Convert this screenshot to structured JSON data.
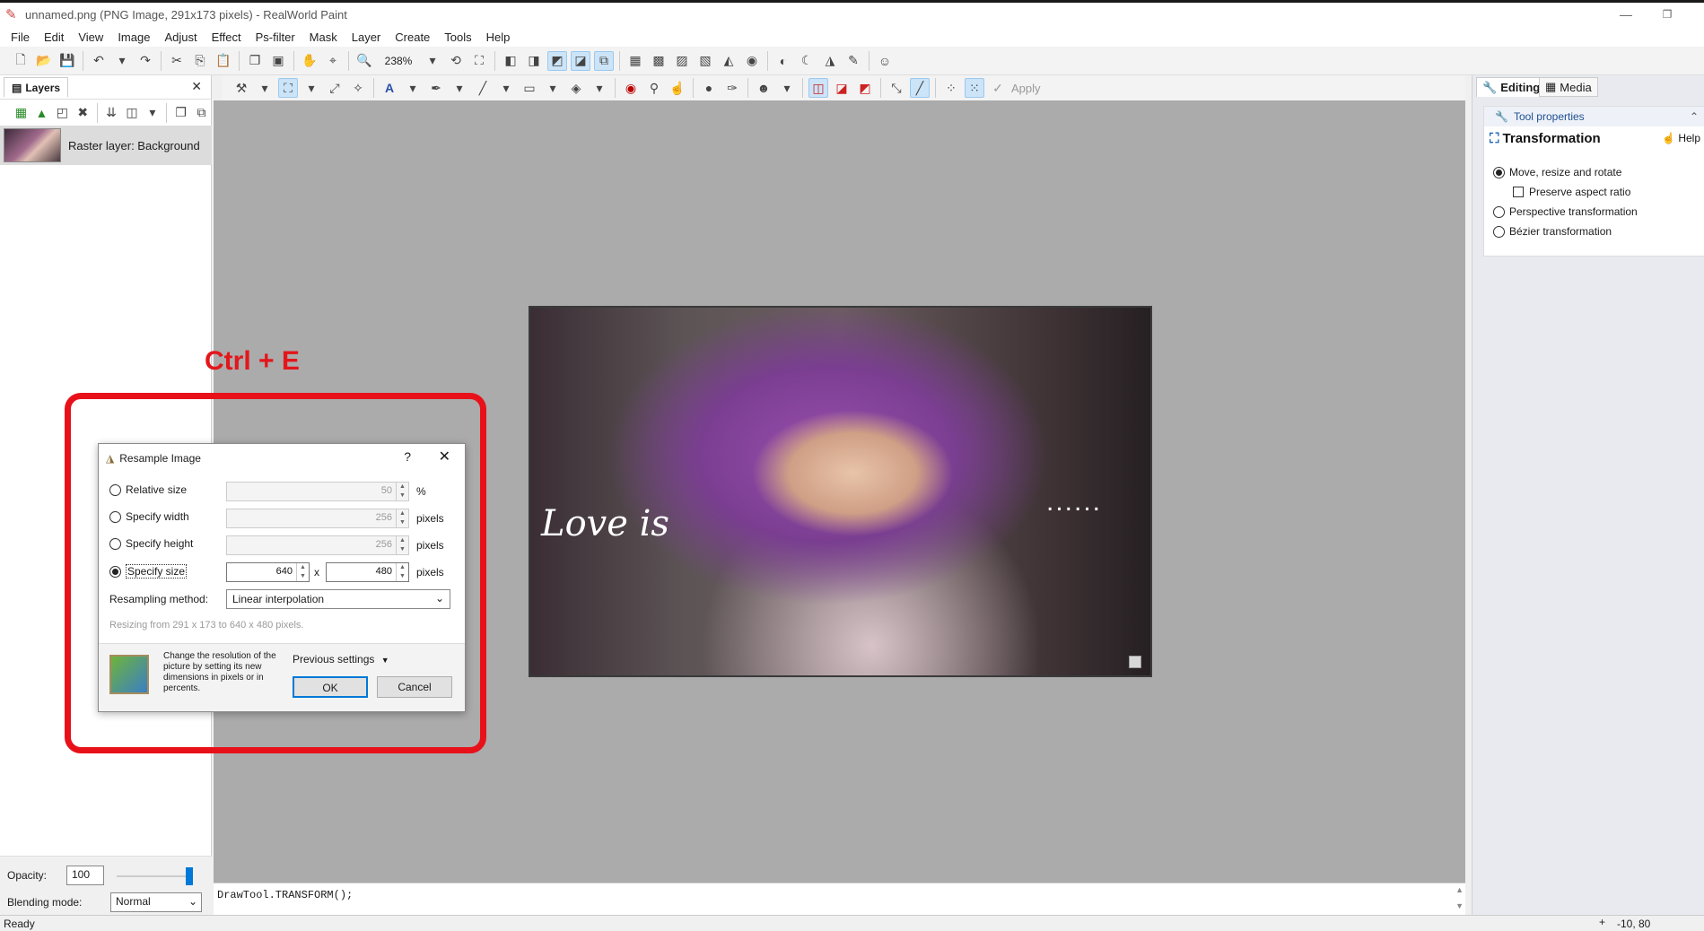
{
  "window": {
    "title": "unnamed.png (PNG Image, 291x173 pixels) - RealWorld Paint",
    "minimize": "—",
    "restore": "❐"
  },
  "menu": [
    "File",
    "Edit",
    "View",
    "Image",
    "Adjust",
    "Effect",
    "Ps-filter",
    "Mask",
    "Layer",
    "Create",
    "Tools",
    "Help"
  ],
  "toolbar": {
    "zoom": "238%",
    "apply_label": "Apply"
  },
  "layers_panel": {
    "tab_label": "Layers",
    "layer_name": "Raster layer: Background",
    "opacity_label": "Opacity:",
    "opacity_value": "100",
    "blending_label": "Blending mode:",
    "blending_value": "Normal"
  },
  "canvas": {
    "overlay_text": "Love is",
    "overlay_dots": "......"
  },
  "script": {
    "code": "DrawTool.TRANSFORM();"
  },
  "right_panel": {
    "tabs": [
      "Editing",
      "Media"
    ],
    "section": "Tool properties",
    "tool_title": "Transformation",
    "help_label": "Help",
    "options": [
      "Move, resize and rotate",
      "Preserve aspect ratio",
      "Perspective transformation",
      "Bézier transformation"
    ]
  },
  "annotation": {
    "shortcut": "Ctrl + E",
    "color": "#e8111a"
  },
  "dialog": {
    "title": "Resample Image",
    "help": "?",
    "rows": [
      {
        "label": "Relative size",
        "value": "50",
        "unit": "%"
      },
      {
        "label": "Specify width",
        "value": "256",
        "unit": "pixels"
      },
      {
        "label": "Specify height",
        "value": "256",
        "unit": "pixels"
      },
      {
        "label": "Specify size",
        "width": "640",
        "x": "x",
        "height": "480",
        "unit": "pixels"
      }
    ],
    "method_label": "Resampling method:",
    "method_value": "Linear interpolation",
    "info": "Resizing from 291 x 173 to 640 x 480 pixels.",
    "description": "Change the resolution of the picture by setting its new dimensions in pixels or in percents.",
    "previous_settings": "Previous settings",
    "ok": "OK",
    "cancel": "Cancel"
  },
  "status": {
    "left": "Ready",
    "coords": "-10, 80"
  }
}
